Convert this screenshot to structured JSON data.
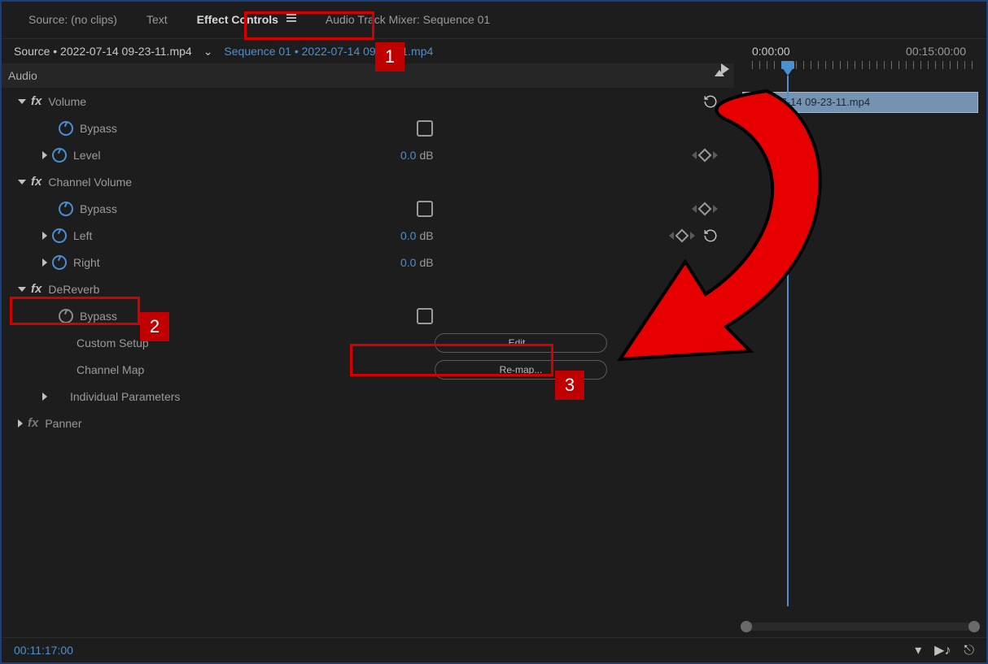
{
  "tabs": {
    "source": "Source: (no clips)",
    "text": "Text",
    "effect_controls": "Effect Controls",
    "audio_mixer": "Audio Track Mixer: Sequence 01"
  },
  "source_line": {
    "prefix": "Source",
    "bullet": "•",
    "clip": "2022-07-14 09-23-11.mp4",
    "seq_label": "Sequence 01",
    "seq_bullet": "•",
    "seq_clip": "2022-07-14 09-23-11.mp4"
  },
  "header_row": "Audio",
  "effects": {
    "volume": {
      "name": "Volume",
      "bypass": "Bypass",
      "level": {
        "label": "Level",
        "value": "0.0",
        "unit": "dB"
      }
    },
    "channel_volume": {
      "name": "Channel Volume",
      "bypass": "Bypass",
      "left": {
        "label": "Left",
        "value": "0.0",
        "unit": "dB"
      },
      "right": {
        "label": "Right",
        "value": "0.0",
        "unit": "dB"
      }
    },
    "dereverb": {
      "name": "DeReverb",
      "bypass": "Bypass",
      "custom_setup": "Custom Setup",
      "edit_btn": "Edit...",
      "channel_map": "Channel Map",
      "remap_btn": "Re-map...",
      "params": "Individual Parameters"
    },
    "panner": {
      "name": "Panner"
    }
  },
  "timeline": {
    "start_tc": "0:00:00",
    "end_tc": "00:15:00:00",
    "clip_name": "2022-07-14 09-23-11.mp4"
  },
  "bottom": {
    "timecode": "00:11:17:00"
  },
  "annotations": {
    "n1": "1",
    "n2": "2",
    "n3": "3"
  }
}
